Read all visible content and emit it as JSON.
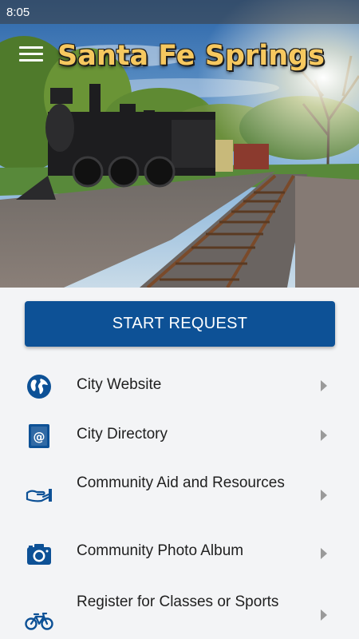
{
  "status_bar": {
    "time": "8:05"
  },
  "header": {
    "title": "Santa Fe Springs"
  },
  "start_request": {
    "label": "START REQUEST"
  },
  "menu": {
    "items": [
      {
        "label": "City Website",
        "icon": "globe-icon"
      },
      {
        "label": "City Directory",
        "icon": "address-book-icon"
      },
      {
        "label": "Community Aid and Resources",
        "icon": "helping-hand-icon"
      },
      {
        "label": "Community Photo Album",
        "icon": "camera-icon"
      },
      {
        "label": "Register for Classes or Sports",
        "icon": "bicycle-icon"
      }
    ]
  },
  "colors": {
    "accent": "#0d5196",
    "title": "#f6c85f",
    "background": "#f3f4f6"
  }
}
